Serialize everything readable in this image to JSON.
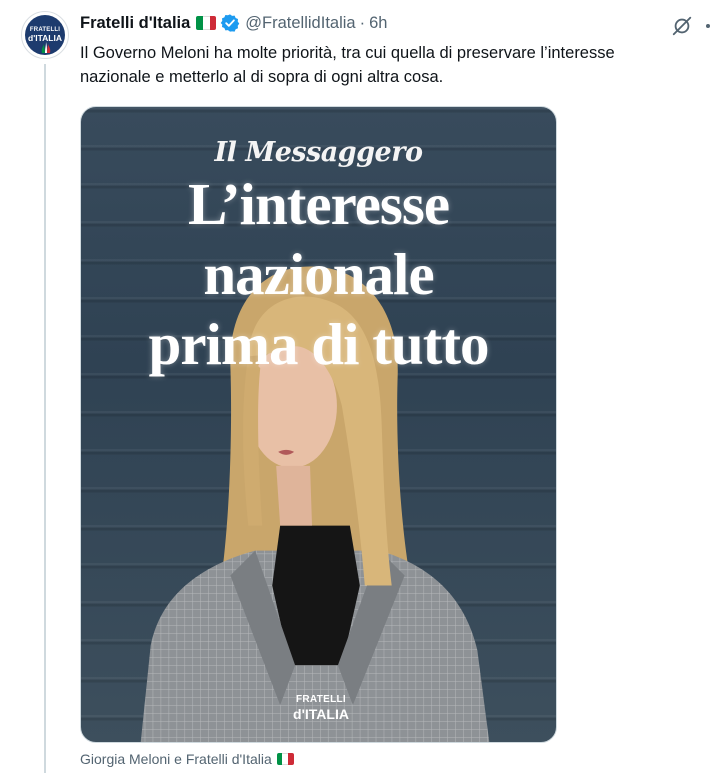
{
  "tweet": {
    "author_name": "Fratelli d'Italia",
    "handle": "@FratellidItalia",
    "separator": "·",
    "time": "6h",
    "text_line1": "Il Governo Meloni ha molte priorità, tra cui quella di preservare l’interesse",
    "text_line2": "nazionale e metterlo al di sopra di ogni altra cosa."
  },
  "avatar": {
    "line1": "FRATELLI",
    "line2": "d'ITALIA"
  },
  "media": {
    "masthead": "Il Messaggero",
    "headline_line1": "L’interesse",
    "headline_line2": "nazionale",
    "headline_line3": "prima di tutto",
    "logo_line1": "FRATELLI",
    "logo_line2": "d'ITALIA"
  },
  "caption": {
    "text": "Giorgia Meloni e Fratelli d'Italia"
  },
  "icons": {
    "flag": "italy-flag-icon",
    "verified": "verified-badge-icon",
    "grok": "grok-icon",
    "more": "more-icon"
  },
  "colors": {
    "verified_blue": "#1d9bf0",
    "secondary_text": "#536471",
    "flag_green": "#009246",
    "flag_white": "#ffffff",
    "flag_red": "#ce2b37"
  }
}
